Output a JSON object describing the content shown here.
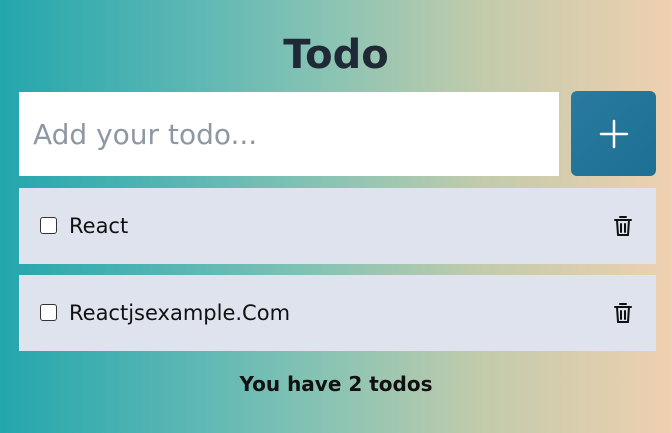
{
  "header": {
    "title": "Todo"
  },
  "new_todo": {
    "placeholder": "Add your todo...",
    "value": "",
    "add_icon": "plus-icon"
  },
  "todos": [
    {
      "label": "React",
      "checked": false,
      "delete_icon": "trash-icon"
    },
    {
      "label": "Reactjsexample.Com",
      "checked": false,
      "delete_icon": "trash-icon"
    }
  ],
  "footer": {
    "count_text": "You have 2 todos"
  },
  "colors": {
    "title": "#1f2a36",
    "add_button": "#1d6f93",
    "item_background": "#dee3ee",
    "gradient_start": "#23a6ad",
    "gradient_end": "#efd0b0"
  }
}
